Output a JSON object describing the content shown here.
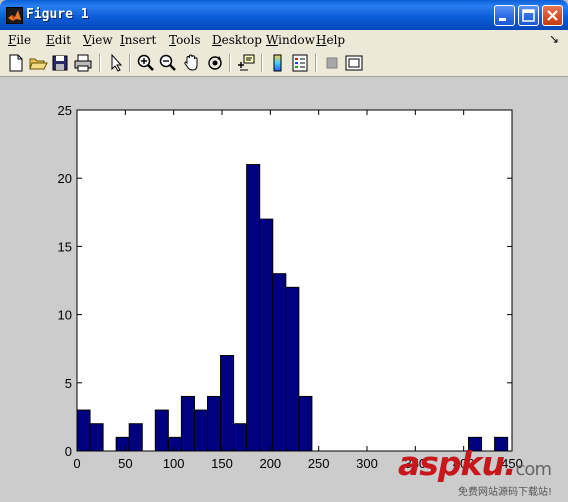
{
  "window": {
    "title": "Figure 1",
    "controls": {
      "minimize_icon": "minimize-icon",
      "maximize_icon": "maximize-icon",
      "close_icon": "close-icon"
    }
  },
  "menubar": {
    "items": [
      {
        "label": "File",
        "mnemonic": "F",
        "rest": "ile"
      },
      {
        "label": "Edit",
        "mnemonic": "E",
        "rest": "dit"
      },
      {
        "label": "View",
        "mnemonic": "V",
        "rest": "iew"
      },
      {
        "label": "Insert",
        "mnemonic": "I",
        "rest": "nsert"
      },
      {
        "label": "Tools",
        "mnemonic": "T",
        "rest": "ools"
      },
      {
        "label": "Desktop",
        "mnemonic": "D",
        "rest": "esktop"
      },
      {
        "label": "Window",
        "mnemonic": "W",
        "rest": "indow"
      },
      {
        "label": "Help",
        "mnemonic": "H",
        "rest": "elp"
      }
    ],
    "dock_arrow": "↘"
  },
  "toolbar": {
    "icons": [
      "new-figure-icon",
      "open-file-icon",
      "save-icon",
      "print-icon",
      "edit-plot-arrow-icon",
      "zoom-in-icon",
      "zoom-out-icon",
      "pan-hand-icon",
      "rotate-3d-icon",
      "data-cursor-icon",
      "colorbar-icon",
      "legend-icon",
      "hide-plot-tools-icon",
      "show-plot-tools-icon"
    ]
  },
  "chart_data": {
    "type": "bar",
    "title": "",
    "xlabel": "",
    "ylabel": "",
    "xlim": [
      0,
      450
    ],
    "ylim": [
      0,
      25
    ],
    "xticks": [
      0,
      50,
      100,
      150,
      200,
      250,
      300,
      350,
      400,
      450
    ],
    "yticks": [
      0,
      5,
      10,
      15,
      20,
      25
    ],
    "bin_width": 13.5,
    "bars": [
      {
        "x": 6.75,
        "value": 3
      },
      {
        "x": 20.25,
        "value": 2
      },
      {
        "x": 33.75,
        "value": 0
      },
      {
        "x": 47.25,
        "value": 1
      },
      {
        "x": 60.75,
        "value": 2
      },
      {
        "x": 74.25,
        "value": 0
      },
      {
        "x": 87.75,
        "value": 3
      },
      {
        "x": 101.25,
        "value": 1
      },
      {
        "x": 114.75,
        "value": 4
      },
      {
        "x": 128.25,
        "value": 3
      },
      {
        "x": 141.75,
        "value": 4
      },
      {
        "x": 155.25,
        "value": 7
      },
      {
        "x": 168.75,
        "value": 2
      },
      {
        "x": 182.25,
        "value": 21
      },
      {
        "x": 195.75,
        "value": 17
      },
      {
        "x": 209.25,
        "value": 13
      },
      {
        "x": 222.75,
        "value": 12
      },
      {
        "x": 236.25,
        "value": 4
      },
      {
        "x": 249.75,
        "value": 0
      },
      {
        "x": 263.25,
        "value": 0
      },
      {
        "x": 276.75,
        "value": 0
      },
      {
        "x": 290.25,
        "value": 0
      },
      {
        "x": 303.75,
        "value": 0
      },
      {
        "x": 317.25,
        "value": 0
      },
      {
        "x": 330.75,
        "value": 0
      },
      {
        "x": 344.25,
        "value": 0
      },
      {
        "x": 357.75,
        "value": 0
      },
      {
        "x": 371.25,
        "value": 0
      },
      {
        "x": 384.75,
        "value": 0
      },
      {
        "x": 398.25,
        "value": 0
      },
      {
        "x": 411.75,
        "value": 1
      },
      {
        "x": 425.25,
        "value": 0
      },
      {
        "x": 438.75,
        "value": 1
      }
    ],
    "bar_color": "#000080",
    "edge_color": "#000000",
    "grid": false
  },
  "watermark": {
    "main": "aspku",
    "dot": ".",
    "tld": "com",
    "sub": "免费网站源码下载站!"
  }
}
